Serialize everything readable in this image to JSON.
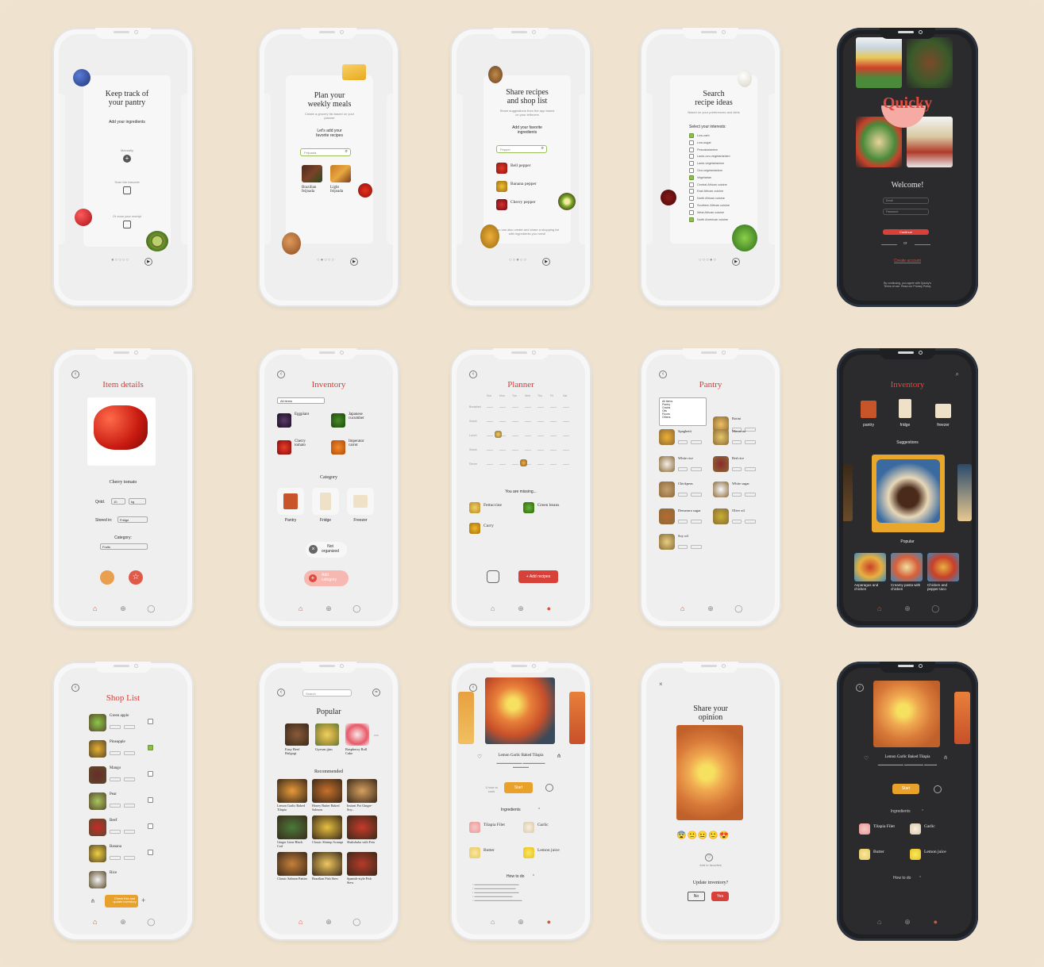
{
  "onboarding": [
    {
      "title": "Keep track of\nyour pantry",
      "subtitle": "Add your ingredients",
      "opt1": "Manually",
      "opt2": "Scan the barcode",
      "opt3": "Or scan your receipt"
    },
    {
      "title": "Plan your\nweekly meals",
      "desc": "Create a grocery list based on your planner",
      "subtitle": "Let's add your\nfavorite recipes",
      "search_placeholder": "Feijoada",
      "recipes": [
        "Brazilian feijoada",
        "Light feijoada"
      ],
      "meta": "3 / 10 ingredients"
    },
    {
      "title": "Share recipes\nand shop list",
      "desc": "Share suggestions from the app based on your leftovers",
      "subtitle": "Add your favorite\ningredients",
      "search_placeholder": "Pepper",
      "items": [
        "Bell pepper",
        "Banana pepper",
        "Cherry pepper"
      ],
      "note": "You can also create and share a shopping list with ingredients you need!"
    },
    {
      "title": "Search\nrecipe ideas",
      "desc": "Based on your preferences and diets",
      "subtitle": "Select your interests:",
      "interests": [
        {
          "label": "Low-carb",
          "checked": true
        },
        {
          "label": "Low-sugar",
          "checked": false
        },
        {
          "label": "Pescatarianism",
          "checked": false
        },
        {
          "label": "Lacto-ovo-vegetarianism",
          "checked": false
        },
        {
          "label": "Lacto-vegetarianism",
          "checked": false
        },
        {
          "label": "Ovo-vegetarianism",
          "checked": false
        },
        {
          "label": "Vegetarian",
          "checked": true
        },
        {
          "label": "Central African cuisine",
          "checked": false
        },
        {
          "label": "East African cuisine",
          "checked": false
        },
        {
          "label": "North African cuisine",
          "checked": false
        },
        {
          "label": "Southern African cuisine",
          "checked": false
        },
        {
          "label": "West African cuisine",
          "checked": false
        },
        {
          "label": "North American cuisine",
          "checked": true
        }
      ]
    }
  ],
  "login": {
    "brand": "Quicky",
    "welcome": "Welcome!",
    "email_placeholder": "Email",
    "password_placeholder": "Password",
    "continue": "Continue",
    "or": "or",
    "create": "Create account",
    "legal": "By continuing, you agree with Quicky's Terms of use. Read our Privacy Policy."
  },
  "item_details": {
    "title": "Item details",
    "name": "Cherry tomato",
    "qty_label": "Qntd.",
    "qty": "10",
    "unit": "kg",
    "stored_label": "Stored in:",
    "stored": "Fridge",
    "category_label": "Category:",
    "category": "Fruits"
  },
  "inventory": {
    "title": "Inventory",
    "filter": "All items",
    "items": [
      "Eggplant",
      "Japanese cucumber",
      "Cherry tomato",
      "Imperator carrot"
    ],
    "units": [
      "unit",
      "unit",
      "pkgs",
      "kg"
    ],
    "category_title": "Category",
    "categories": [
      "Pantry",
      "Fridge",
      "Freezer"
    ],
    "not_org": "Not\norganized",
    "add_cat": "Add\ncategory"
  },
  "planner": {
    "title": "Planner",
    "days": [
      "Sun",
      "Mon",
      "Tue",
      "Wed",
      "Thu",
      "Fri",
      "Sat"
    ],
    "meals": [
      "Breakfast",
      "Snack",
      "Lunch",
      "Snack",
      "Dinner"
    ],
    "missing": "You are missing...",
    "missing_items": [
      "Fettuccine",
      "Green beans",
      "Curry"
    ],
    "add": "Add recipes"
  },
  "pantry": {
    "title": "Pantry",
    "filter": "All items",
    "filter_opts": [
      "Pantry",
      "Grains",
      "Oils",
      "Flours",
      "Others"
    ],
    "items": [
      "Rotini",
      "Spaghetti",
      "Macaroni",
      "White rice",
      "Red rice",
      "Chickpeas",
      "White sugar",
      "Demerara sugar",
      "Olive oil",
      "Soy oil"
    ]
  },
  "inventory_dark": {
    "title": "Inventory",
    "cats": [
      "pantry",
      "fridge",
      "freezer"
    ],
    "suggestions": "Suggestions",
    "popular": "Popular",
    "popular_items": [
      "Asparagus and chicken",
      "Creamy pasta with chicken",
      "Chicken and pepper taco"
    ]
  },
  "shop": {
    "title": "Shop List",
    "items": [
      {
        "name": "Green apple",
        "checked": false
      },
      {
        "name": "Pineapple",
        "checked": true
      },
      {
        "name": "Mango",
        "checked": false
      },
      {
        "name": "Pear",
        "checked": false
      },
      {
        "name": "Beef",
        "checked": false
      },
      {
        "name": "Banana",
        "checked": false
      },
      {
        "name": "Rice",
        "checked": false
      }
    ],
    "cta": "Check this and update inventory"
  },
  "popular": {
    "search": "Search",
    "title": "Popular",
    "top": [
      "Easy Beef Bulgogi",
      "Gyeran jjim",
      "Raspberry Roll Cake"
    ],
    "recommended": "Recommended",
    "grid": [
      "Lemon Garlic Baked Tilapia",
      "Honey Butter Baked Salmon",
      "Instant Pot Ginger-Soy...",
      "Ginger Lime Black Cod",
      "Classic Shrimp Scampi",
      "Shakshuka with Feta",
      "Classic Salmon Patties",
      "Brazilian Fish Stew",
      "Spanish-style Fish Stew"
    ]
  },
  "recipe": {
    "title": "Lemon Garlic Baked Tilapia",
    "start": "Start",
    "time": "1 hour to cook",
    "ingredients": "Ingredients",
    "ing": [
      "Tilapia Filet",
      "Garlic",
      "Butter",
      "Lemon juice"
    ],
    "howto": "How to do"
  },
  "opinion": {
    "title": "Share your\nopinion",
    "update": "Update inventory?",
    "no": "No",
    "yes": "Yes",
    "add_fav": "Add to favorites"
  },
  "recipe_dark": {
    "title": "Lemon Garlic Baked Tilapia",
    "start": "Start",
    "ingredients": "Ingredients",
    "ing": [
      "Tilapia Filet",
      "Garlic",
      "Butter",
      "Lemon juice"
    ],
    "howto": "How to do"
  }
}
